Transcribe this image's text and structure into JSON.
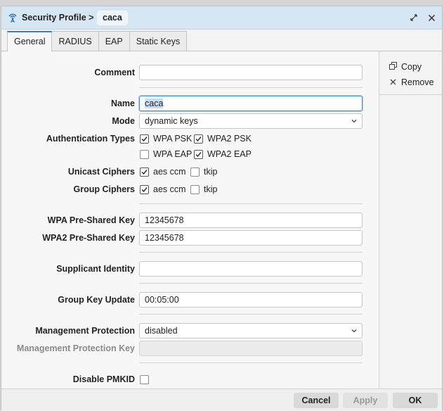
{
  "window": {
    "title": "Security Profile",
    "separator": ">",
    "profile_name": "caca"
  },
  "tabs": [
    {
      "label": "General",
      "active": true
    },
    {
      "label": "RADIUS",
      "active": false
    },
    {
      "label": "EAP",
      "active": false
    },
    {
      "label": "Static Keys",
      "active": false
    }
  ],
  "side_actions": {
    "copy_label": "Copy",
    "remove_label": "Remove"
  },
  "form": {
    "comment": {
      "label": "Comment",
      "value": ""
    },
    "name": {
      "label": "Name",
      "value": "caca"
    },
    "mode": {
      "label": "Mode",
      "value": "dynamic keys"
    },
    "auth_types": {
      "label": "Authentication Types",
      "options": [
        {
          "label": "WPA PSK",
          "checked": true
        },
        {
          "label": "WPA2 PSK",
          "checked": true
        },
        {
          "label": "WPA EAP",
          "checked": false
        },
        {
          "label": "WPA2 EAP",
          "checked": true
        }
      ]
    },
    "unicast_ciphers": {
      "label": "Unicast Ciphers",
      "options": [
        {
          "label": "aes ccm",
          "checked": true
        },
        {
          "label": "tkip",
          "checked": false
        }
      ]
    },
    "group_ciphers": {
      "label": "Group Ciphers",
      "options": [
        {
          "label": "aes ccm",
          "checked": true
        },
        {
          "label": "tkip",
          "checked": false
        }
      ]
    },
    "wpa_psk": {
      "label": "WPA Pre-Shared Key",
      "value": "12345678"
    },
    "wpa2_psk": {
      "label": "WPA2 Pre-Shared Key",
      "value": "12345678"
    },
    "supplicant_identity": {
      "label": "Supplicant Identity",
      "value": ""
    },
    "group_key_update": {
      "label": "Group Key Update",
      "value": "00:05:00"
    },
    "management_protection": {
      "label": "Management Protection",
      "value": "disabled"
    },
    "management_protection_key": {
      "label": "Management Protection Key",
      "value": ""
    },
    "disable_pmkid": {
      "label": "Disable PMKID",
      "checked": false
    }
  },
  "footer": {
    "cancel_label": "Cancel",
    "apply_label": "Apply",
    "ok_label": "OK"
  },
  "colors": {
    "titlebar": "#d6e6f3",
    "accent": "#3a7fc1",
    "focus": "#4a90d9"
  },
  "icons": {
    "app": "wireless-antenna-icon",
    "restore": "restore-window-icon",
    "close": "close-icon",
    "copy": "copy-icon",
    "remove": "remove-x-icon",
    "check": "checkmark-icon",
    "dropdown": "chevron-down-icon"
  }
}
